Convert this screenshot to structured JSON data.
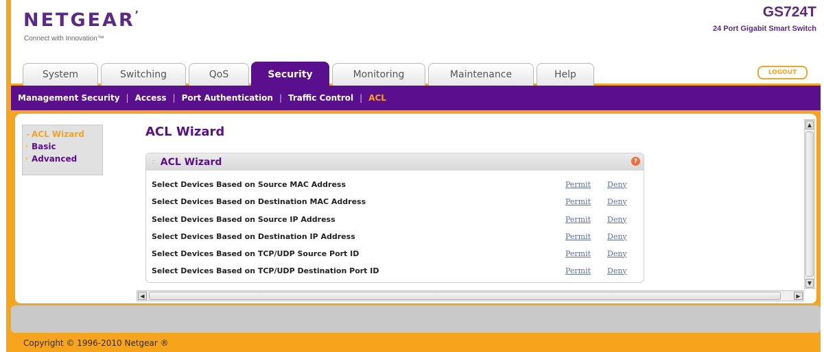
{
  "brand": {
    "logo": "NETGEAR",
    "tagline": "Connect with Innovation™",
    "model": "GS724T",
    "model_desc": "24 Port Gigabit Smart Switch"
  },
  "tabs": [
    {
      "label": "System",
      "active": false
    },
    {
      "label": "Switching",
      "active": false
    },
    {
      "label": "QoS",
      "active": false
    },
    {
      "label": "Security",
      "active": true
    },
    {
      "label": "Monitoring",
      "active": false
    },
    {
      "label": "Maintenance",
      "active": false
    },
    {
      "label": "Help",
      "active": false
    }
  ],
  "logout_label": "LOGOUT",
  "subnav": [
    {
      "label": "Management Security",
      "active": false
    },
    {
      "label": "Access",
      "active": false
    },
    {
      "label": "Port Authentication",
      "active": false
    },
    {
      "label": "Traffic Control",
      "active": false
    },
    {
      "label": "ACL",
      "active": true
    }
  ],
  "subnav_sep": "|",
  "leftnav": [
    {
      "label": "ACL Wizard",
      "arrow": "⌄",
      "active": true
    },
    {
      "label": "Basic",
      "arrow": "›",
      "active": false
    },
    {
      "label": "Advanced",
      "arrow": "›",
      "active": false
    }
  ],
  "page_title": "ACL Wizard",
  "box": {
    "title": "ACL Wizard",
    "help_icon": "?",
    "rows": [
      {
        "label": "Select Devices Based on Source MAC Address",
        "permit": "Permit",
        "deny": "Deny"
      },
      {
        "label": "Select Devices Based on Destination MAC Address",
        "permit": "Permit",
        "deny": "Deny"
      },
      {
        "label": "Select Devices Based on Source IP Address",
        "permit": "Permit",
        "deny": "Deny"
      },
      {
        "label": "Select Devices Based on Destination IP Address",
        "permit": "Permit",
        "deny": "Deny"
      },
      {
        "label": "Select Devices Based on TCP/UDP Source Port ID",
        "permit": "Permit",
        "deny": "Deny"
      },
      {
        "label": "Select Devices Based on TCP/UDP Destination Port ID",
        "permit": "Permit",
        "deny": "Deny"
      }
    ]
  },
  "copyright": "Copyright © 1996-2010 Netgear ®",
  "colors": {
    "purple": "#5a0f8f",
    "orange": "#f7a41d",
    "link": "#5c6fb0"
  }
}
